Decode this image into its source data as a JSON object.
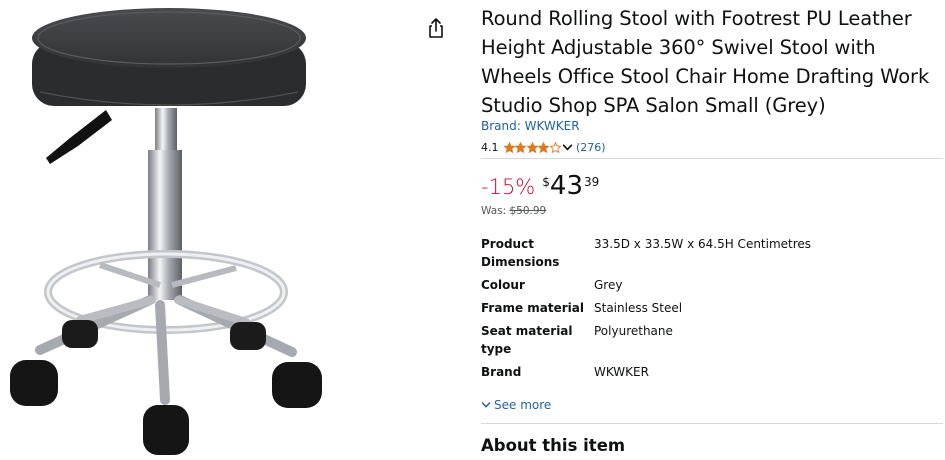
{
  "product": {
    "title": "Round Rolling Stool with Footrest PU Leather Height Adjustable 360° Swivel Stool with Wheels Office Stool Chair Home Drafting Work Studio Shop SPA Salon Small (Grey)",
    "brand_link": "Brand: WKWKER",
    "rating": "4.1",
    "rating_value": 4.1,
    "rating_max": 5,
    "review_count": "(276)",
    "discount": "-15%",
    "price_symbol": "$",
    "price_whole": "43",
    "price_fraction": "39",
    "was_label": "Was:",
    "was_price": "$50.99"
  },
  "specs": [
    {
      "label": "Product Dimensions",
      "value": "33.5D x 33.5W x 64.5H Centimetres"
    },
    {
      "label": "Colour",
      "value": "Grey"
    },
    {
      "label": "Frame material",
      "value": "Stainless Steel"
    },
    {
      "label": "Seat material type",
      "value": "Polyurethane"
    },
    {
      "label": "Brand",
      "value": "WKWKER"
    }
  ],
  "see_more": "See more",
  "about_heading": "About this item",
  "icons": {
    "share": "share-icon",
    "star": "star-icon",
    "chevron": "chevron-down-icon"
  },
  "colors": {
    "star": "#de7921",
    "link": "#2162a1",
    "discount": "#cc0c39",
    "seat": "#3d3d3f"
  }
}
